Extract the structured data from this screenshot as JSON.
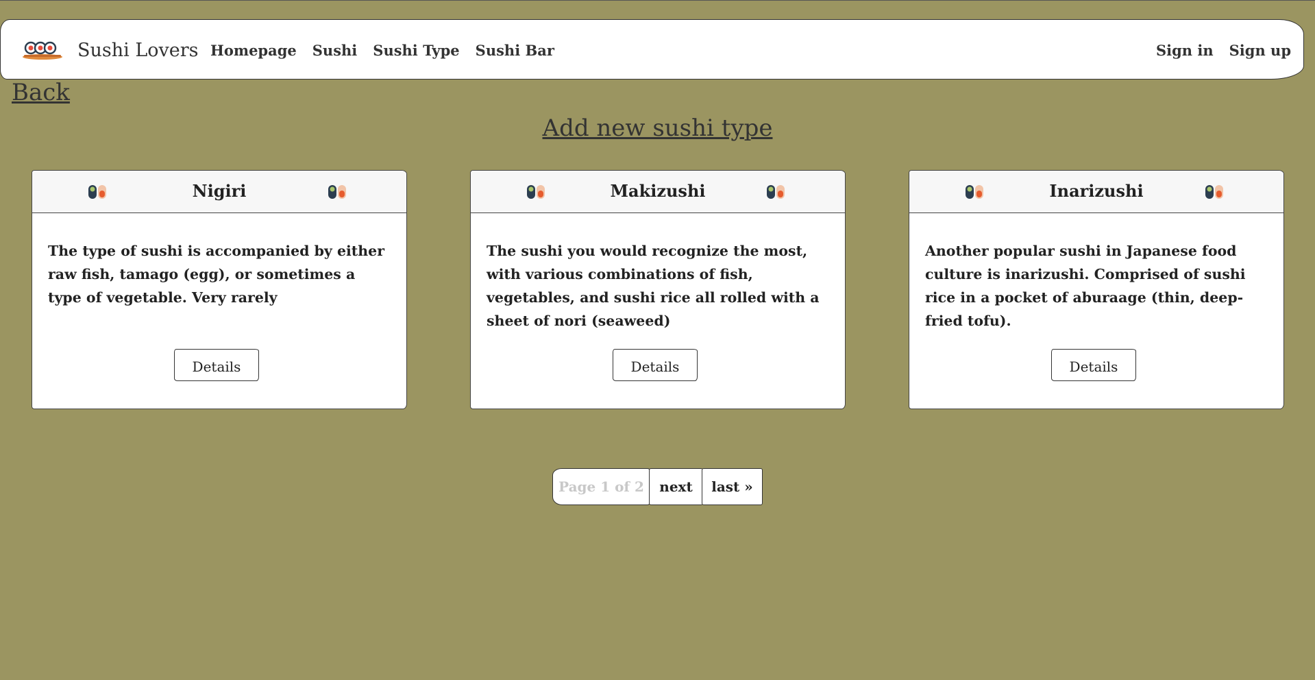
{
  "nav": {
    "brand": "Sushi Lovers",
    "links": [
      "Homepage",
      "Sushi",
      "Sushi Type",
      "Sushi Bar"
    ],
    "sign_in": "Sign in",
    "sign_up": "Sign up"
  },
  "back_label": "Back",
  "add_label": "Add new sushi type",
  "cards": [
    {
      "title": "Nigiri",
      "description": "The type of sushi is accompanied by either raw fish, tamago (egg), or sometimes a type of vegetable. Very rarely",
      "button": "Details"
    },
    {
      "title": "Makizushi",
      "description": "The sushi you would recognize the most, with various combinations of fish, vegetables, and sushi rice all rolled with a sheet of nori (seaweed)",
      "button": "Details"
    },
    {
      "title": "Inarizushi",
      "description": "Another popular sushi in Japanese food culture is inarizushi. Comprised of sushi rice in a pocket of aburaage (thin, deep-fried tofu).",
      "button": "Details"
    }
  ],
  "pagination": {
    "info": "Page 1 of 2",
    "next": "next",
    "last": "last »"
  },
  "colors": {
    "background": "#9b9561",
    "surface": "#ffffff",
    "text": "#222222",
    "muted": "#c8c8c8"
  },
  "icons": {
    "brand": "sushi-platter-icon",
    "card_decor": "sushi-rolls-icon"
  }
}
